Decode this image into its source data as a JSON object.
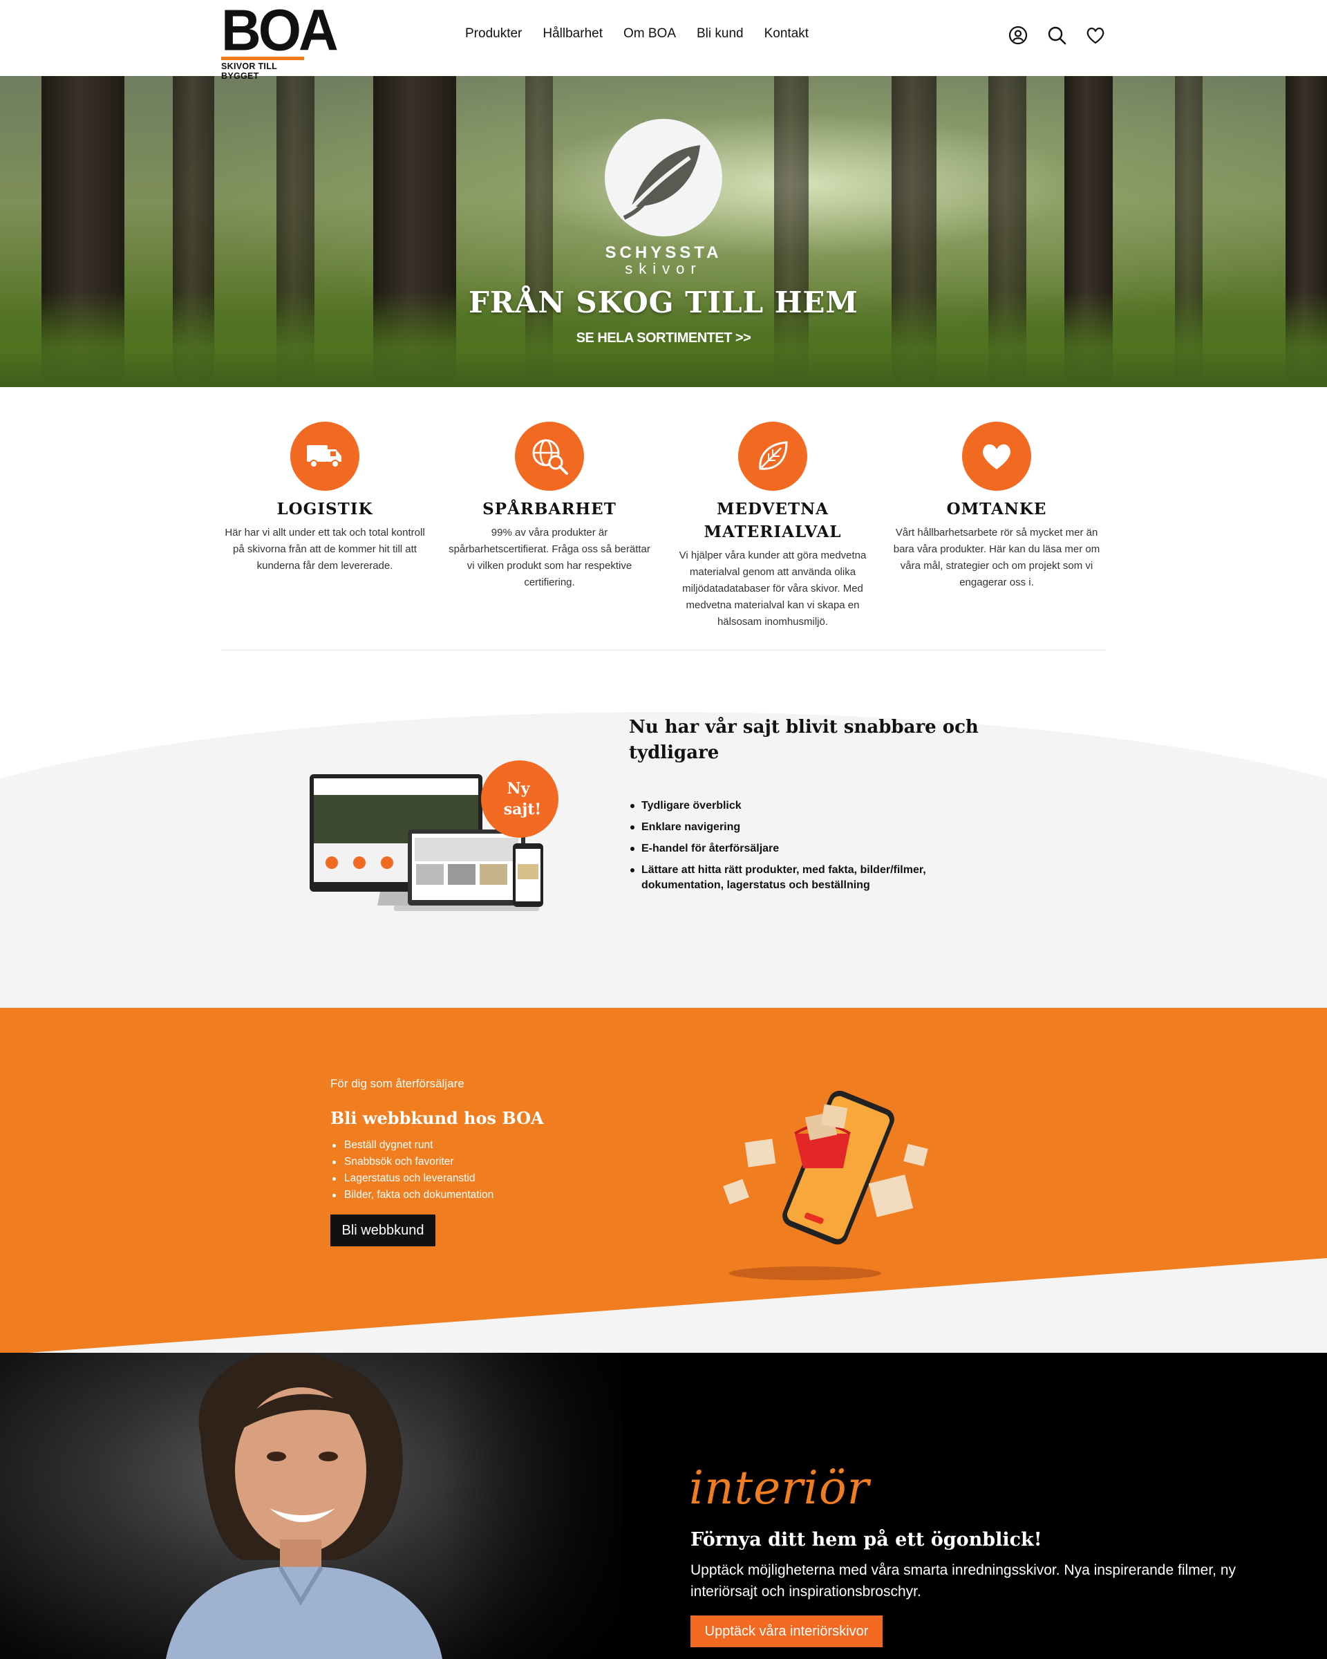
{
  "brand": {
    "logo_text": "BOA",
    "logo_tagline": "SKIVOR TILL BYGGET",
    "accent_color": "#f07d20"
  },
  "nav": {
    "items": [
      {
        "label": "Produkter"
      },
      {
        "label": "Hållbarhet"
      },
      {
        "label": "Om BOA"
      },
      {
        "label": "Bli kund"
      },
      {
        "label": "Kontakt"
      }
    ],
    "icons": [
      "account-icon",
      "search-icon",
      "heart-icon"
    ]
  },
  "hero": {
    "emblem_line1": "SCHYSSTA",
    "emblem_line2": "skivor",
    "title": "FRÅN SKOG TILL HEM",
    "link": "SE HELA SORTIMENTET >>"
  },
  "features": [
    {
      "icon": "truck-icon",
      "title": "LOGISTIK",
      "text": "Här har vi allt under ett tak och total kontroll på skivorna från att de kommer hit till att kunderna får dem levererade."
    },
    {
      "icon": "globe-search-icon",
      "title": "SPÅRBARHET",
      "text": "99% av våra produkter är spårbarhetscertifierat. Fråga oss så berättar vi vilken produkt som har respektive certifiering."
    },
    {
      "icon": "leaf-icon",
      "title": "MEDVETNA MATERIALVAL",
      "text": "Vi hjälper våra kunder att göra medvetna materialval genom att använda olika miljödatadatabaser för våra skivor. Med medvetna materialval kan vi skapa en hälsosam inomhusmiljö."
    },
    {
      "icon": "heart-icon",
      "title": "OMTANKE",
      "text": "Vårt hållbarhetsarbete rör så mycket mer än bara våra produkter. Här kan du läsa mer om våra mål, strategier och om projekt som vi engagerar oss i."
    }
  ],
  "newsite": {
    "badge": "Ny sajt!",
    "title": "Nu har vår sajt blivit snabbare och tydligare",
    "bullets": [
      "Tydligare överblick",
      "Enklare navigering",
      "E-handel för återförsäljare",
      "Lättare att hitta rätt produkter, med fakta, bilder/filmer, dokumentation, lagerstatus och beställning"
    ]
  },
  "reseller": {
    "kicker": "För dig som återförsäljare",
    "title": "Bli webbkund hos BOA",
    "bullets": [
      "Beställ dygnet runt",
      "Snabbsök och favoriter",
      "Lagerstatus och leveranstid",
      "Bilder, fakta och dokumentation"
    ],
    "button": "Bli webbkund"
  },
  "interior": {
    "script_title": "interiör",
    "title": "Förnya ditt hem på ett ögonblick!",
    "text": "Upptäck möjligheterna med våra smarta inredningsskivor. Nya inspirerande filmer, ny interiörsajt och inspirationsbroschyr.",
    "button": "Upptäck våra interiörskivor"
  }
}
